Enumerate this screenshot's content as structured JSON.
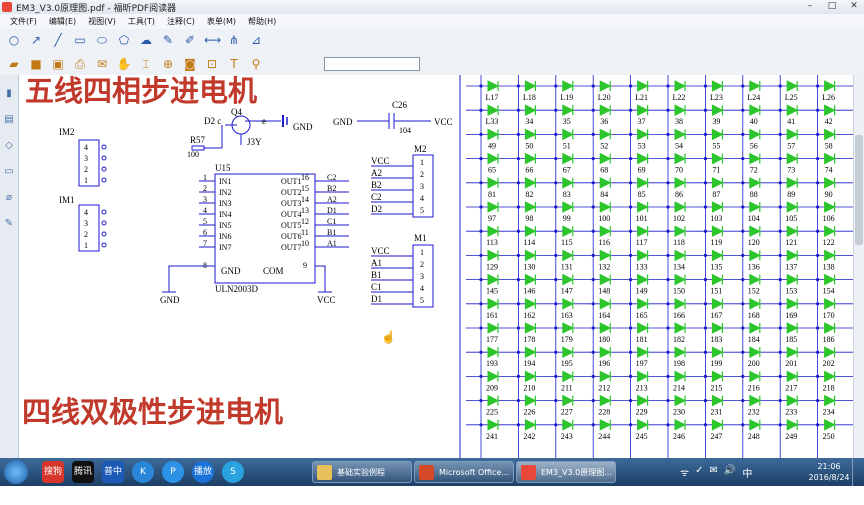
{
  "window": {
    "title": "EM3_V3.0原理图.pdf - 福昕PDF阅读器",
    "minimize": "–",
    "maximize": "□",
    "close": "✕"
  },
  "menu": [
    "文件(F)",
    "编辑(E)",
    "视图(V)",
    "工具(T)",
    "注释(C)",
    "表单(M)",
    "帮助(H)"
  ],
  "toolbar1_icons": [
    "circle-tool-icon",
    "arrow-tool-icon",
    "line-tool-icon",
    "rectangle-tool-icon",
    "ellipse-tool-icon",
    "polygon-tool-icon",
    "cloud-tool-icon",
    "pencil-tool-icon",
    "highlighter-tool-icon",
    "distance-tool-icon",
    "perimeter-tool-icon",
    "area-tool-icon"
  ],
  "toolbar2_icons": [
    "open-icon",
    "save-icon",
    "save-as-icon",
    "print-icon",
    "email-icon",
    "hand-icon",
    "select-icon",
    "zoom-icon",
    "snapshot-icon",
    "fit-icon",
    "typewriter-icon",
    "find-icon"
  ],
  "schematic": {
    "heading1": "五线四相步进电机",
    "heading2": "四线双极性步进电机",
    "q4": "Q4",
    "d2c": "D2 c",
    "e": "e",
    "gnd": "GND",
    "j3y": "J3Y",
    "r57": "R57",
    "r57_val": "100",
    "c26": "C26",
    "c26_val": "104",
    "vcc": "VCC",
    "im2": "IM2",
    "im1": "IM1",
    "u15": "U15",
    "uln": "ULN2003D",
    "ic_gnd": "GND",
    "ic_com": "COM",
    "ic_pin8": "8",
    "ic_pin9": "9",
    "connector_pins": [
      "4",
      "3",
      "2",
      "1"
    ],
    "inputs": [
      {
        "num": "1",
        "name": "IN1"
      },
      {
        "num": "2",
        "name": "IN2"
      },
      {
        "num": "3",
        "name": "IN3"
      },
      {
        "num": "4",
        "name": "IN4"
      },
      {
        "num": "5",
        "name": "IN5"
      },
      {
        "num": "6",
        "name": "IN6"
      },
      {
        "num": "7",
        "name": "IN7"
      }
    ],
    "outputs": [
      {
        "name": "OUT1",
        "num": "16",
        "net": "C2"
      },
      {
        "name": "OUT2",
        "num": "15",
        "net": "B2"
      },
      {
        "name": "OUT3",
        "num": "14",
        "net": "A2"
      },
      {
        "name": "OUT4",
        "num": "13",
        "net": "D1"
      },
      {
        "name": "OUT5",
        "num": "12",
        "net": "C1"
      },
      {
        "name": "OUT6",
        "num": "11",
        "net": "B1"
      },
      {
        "name": "OUT7",
        "num": "10",
        "net": "A1"
      }
    ],
    "m2": {
      "label": "M2",
      "nets": [
        "VCC",
        "A2",
        "B2",
        "C2",
        "D2"
      ],
      "pins": [
        "1",
        "2",
        "3",
        "4",
        "5"
      ]
    },
    "m1": {
      "label": "M1",
      "nets": [
        "VCC",
        "A1",
        "B1",
        "C1",
        "D1"
      ],
      "pins": [
        "1",
        "2",
        "3",
        "4",
        "5"
      ]
    }
  },
  "led_matrix": {
    "rows": [
      [
        "L17",
        "L18",
        "L19",
        "L20",
        "L21",
        "L22",
        "L23",
        "L24",
        "L25",
        "L26"
      ],
      [
        "L33",
        "34",
        "35",
        "36",
        "37",
        "38",
        "39",
        "40",
        "41",
        "42"
      ],
      [
        "49",
        "50",
        "51",
        "52",
        "53",
        "54",
        "55",
        "56",
        "57",
        "58"
      ],
      [
        "65",
        "66",
        "67",
        "68",
        "69",
        "70",
        "71",
        "72",
        "73",
        "74"
      ],
      [
        "81",
        "82",
        "83",
        "84",
        "85",
        "86",
        "87",
        "88",
        "89",
        "90"
      ],
      [
        "97",
        "98",
        "99",
        "100",
        "101",
        "102",
        "103",
        "104",
        "105",
        "106"
      ],
      [
        "113",
        "114",
        "115",
        "116",
        "117",
        "118",
        "119",
        "120",
        "121",
        "122"
      ],
      [
        "129",
        "130",
        "131",
        "132",
        "133",
        "134",
        "135",
        "136",
        "137",
        "138"
      ],
      [
        "145",
        "146",
        "147",
        "148",
        "149",
        "150",
        "151",
        "152",
        "153",
        "154"
      ],
      [
        "161",
        "162",
        "163",
        "164",
        "165",
        "166",
        "167",
        "168",
        "169",
        "170"
      ],
      [
        "177",
        "178",
        "179",
        "180",
        "181",
        "182",
        "183",
        "184",
        "185",
        "186"
      ],
      [
        "193",
        "194",
        "195",
        "196",
        "197",
        "198",
        "199",
        "200",
        "201",
        "202"
      ],
      [
        "209",
        "210",
        "211",
        "212",
        "213",
        "214",
        "215",
        "216",
        "217",
        "218"
      ],
      [
        "225",
        "226",
        "227",
        "228",
        "229",
        "230",
        "231",
        "232",
        "233",
        "234"
      ],
      [
        "241",
        "242",
        "243",
        "244",
        "245",
        "246",
        "247",
        "248",
        "249",
        "250"
      ]
    ],
    "led_color": "#2cc52c",
    "wire_color": "#1a1acc"
  },
  "taskbar": {
    "apps": [
      "搜狗",
      "腾讯QQ",
      "普中ISP",
      "K",
      "P",
      "播放器",
      "S"
    ],
    "tasks": [
      {
        "label": "基础实验例程",
        "active": false
      },
      {
        "label": "Microsoft Office...",
        "active": false
      },
      {
        "label": "EM3_V3.0原理图...",
        "active": true
      }
    ],
    "tray": [
      "ᯤ",
      "✓",
      "✉",
      "🔊",
      "中"
    ],
    "time": "21:06",
    "date": "2016/8/24"
  }
}
